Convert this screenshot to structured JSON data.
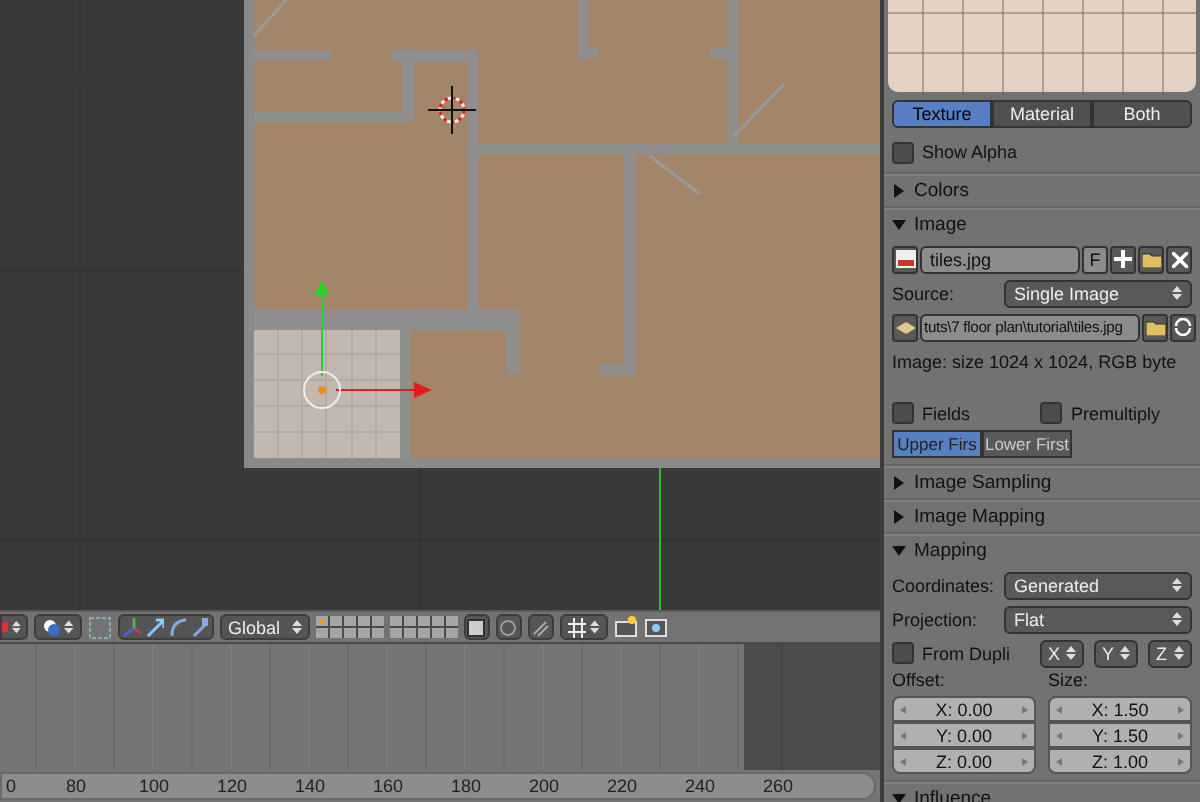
{
  "header": {
    "orientation": "Global"
  },
  "timeline": {
    "ticks": [
      "0",
      "80",
      "100",
      "120",
      "140",
      "160",
      "180",
      "200",
      "220",
      "240",
      "260"
    ]
  },
  "properties": {
    "preview_tabs": [
      {
        "label": "Texture",
        "selected": true
      },
      {
        "label": "Material",
        "selected": false
      },
      {
        "label": "Both",
        "selected": false
      }
    ],
    "show_alpha": {
      "label": "Show Alpha",
      "checked": false
    },
    "panels": [
      {
        "kind": "colors",
        "title": "Colors",
        "expanded": false
      },
      {
        "kind": "image",
        "title": "Image",
        "expanded": true,
        "image_name": "tiles.jpg",
        "fake_user": "F",
        "source_label": "Source:",
        "source": "Single Image",
        "path": "tuts\\7 floor plan\\tutorial\\tiles.jpg",
        "info": "Image: size 1024 x 1024, RGB byte",
        "fields": {
          "label": "Fields",
          "checked": false
        },
        "premultiply": {
          "label": "Premultiply",
          "checked": false
        },
        "field_order": [
          {
            "label": "Upper Firs",
            "selected": true
          },
          {
            "label": "Lower First",
            "selected": false
          }
        ]
      },
      {
        "kind": "sampling",
        "title": "Image Sampling",
        "expanded": false
      },
      {
        "kind": "image_mapping",
        "title": "Image Mapping",
        "expanded": false
      },
      {
        "kind": "mapping",
        "title": "Mapping",
        "expanded": true,
        "coordinates": {
          "label": "Coordinates:",
          "value": "Generated"
        },
        "projection": {
          "label": "Projection:",
          "value": "Flat"
        },
        "from_dupli": {
          "label": "From Dupli",
          "checked": false
        },
        "axes": [
          "X",
          "Y",
          "Z"
        ],
        "offset": {
          "label": "Offset:",
          "values": [
            "X: 0.00",
            "Y: 0.00",
            "Z: 0.00"
          ]
        },
        "size": {
          "label": "Size:",
          "values": [
            "X: 1.50",
            "Y: 1.50",
            "Z: 1.00"
          ]
        }
      },
      {
        "kind": "influence",
        "title": "Influence",
        "expanded": true
      }
    ]
  }
}
